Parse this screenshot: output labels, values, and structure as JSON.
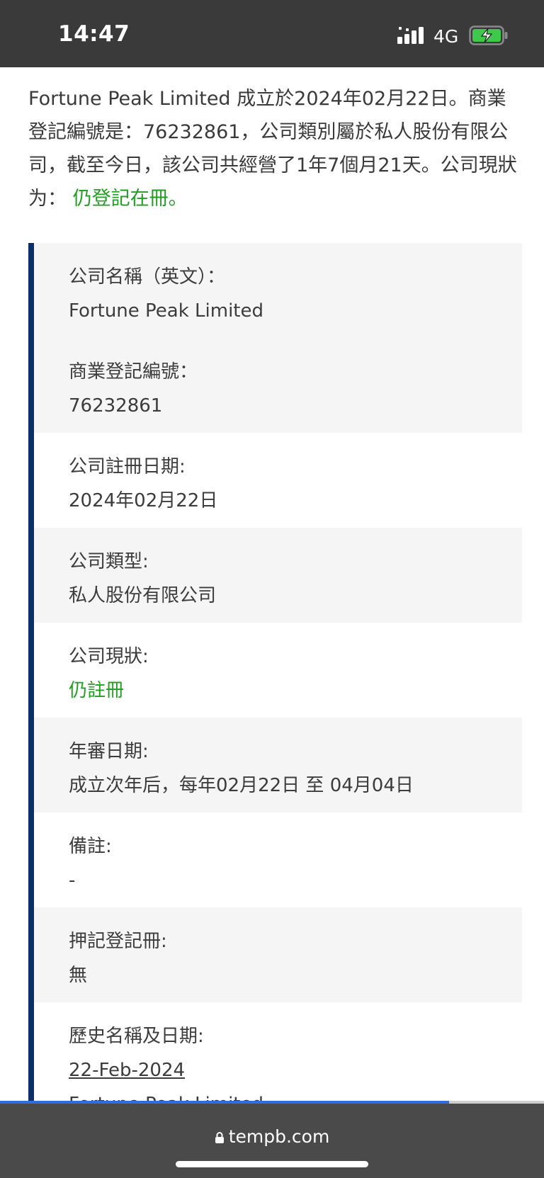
{
  "status_bar": {
    "time": "14:47",
    "network": "4G",
    "icons": [
      "signal-icon",
      "battery-charging-icon"
    ]
  },
  "intro": {
    "text_before_status": "Fortune Peak Limited 成立於2024年02月22日。商業登記編號是：76232861，公司類別屬於私人股份有限公司，截至今日，該公司共經營了1年7個月21天。公司現狀为：",
    "status_text": "仍登記在冊。",
    "status_color": "#1f9e1f"
  },
  "details": {
    "name_en_label": "公司名稱（英文）：",
    "name_en_value": "Fortune Peak Limited",
    "br_no_label": "商業登記編號：",
    "br_no_value": "76232861",
    "reg_date_label": "公司註冊日期:",
    "reg_date_value": "2024年02月22日",
    "type_label": "公司類型:",
    "type_value": "私人股份有限公司",
    "status_label": "公司現狀:",
    "status_value": "仍註冊",
    "annual_label": "年審日期:",
    "annual_value": "成立次年后，每年02月22日 至 04月04日",
    "remarks_label": "備註:",
    "remarks_value": "-",
    "charges_label": "押記登記冊:",
    "charges_value": "無",
    "history_label": "歷史名稱及日期:",
    "history_date": "22-Feb-2024",
    "history_name": "Fortune Peak Limited"
  },
  "browser": {
    "url": "tempb.com",
    "load_progress": 0.825,
    "accent": "#2f6de0"
  }
}
